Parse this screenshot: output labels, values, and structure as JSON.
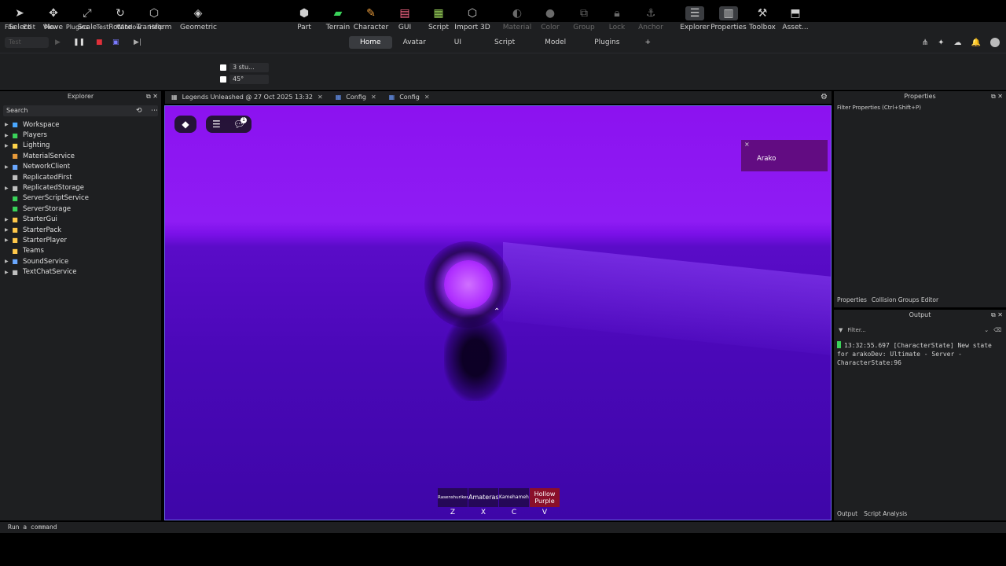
{
  "menu": [
    "File",
    "Edit",
    "View",
    "Plugins",
    "Test",
    "Window",
    "Help"
  ],
  "test_selector": "Test",
  "ribbon_tabs": [
    {
      "label": "Home",
      "active": true
    },
    {
      "label": "Avatar"
    },
    {
      "label": "UI"
    },
    {
      "label": "Script"
    },
    {
      "label": "Model"
    },
    {
      "label": "Plugins"
    },
    {
      "label": "+"
    }
  ],
  "tools": {
    "select": "Select",
    "move": "Move",
    "scale": "Scale",
    "rotate": "Rotate",
    "transform": "Transform",
    "geometric": "Geometric",
    "part": "Part",
    "terrain": "Terrain",
    "character": "Character",
    "gui": "GUI",
    "script": "Script",
    "import3d": "Import 3D",
    "material": "Material",
    "color": "Color",
    "group": "Group",
    "lock": "Lock",
    "anchor": "Anchor",
    "explorer": "Explorer",
    "properties": "Properties",
    "toolbox": "Toolbox",
    "assets": "Asset..."
  },
  "snap": {
    "move": "3 stu...",
    "rotate": "45°"
  },
  "explorer": {
    "title": "Explorer",
    "search_placeholder": "Search",
    "items": [
      {
        "label": "Workspace",
        "expand": true,
        "color": "#4aa8ff"
      },
      {
        "label": "Players",
        "expand": true,
        "color": "#3ad35a"
      },
      {
        "label": "Lighting",
        "expand": true,
        "color": "#ffd34a"
      },
      {
        "label": "MaterialService",
        "expand": false,
        "color": "#e89a3a"
      },
      {
        "label": "NetworkClient",
        "expand": true,
        "color": "#6aa8ff"
      },
      {
        "label": "ReplicatedFirst",
        "expand": false,
        "color": "#c0c0c0"
      },
      {
        "label": "ReplicatedStorage",
        "expand": true,
        "color": "#c0c0c0"
      },
      {
        "label": "ServerScriptService",
        "expand": false,
        "color": "#3ad35a"
      },
      {
        "label": "ServerStorage",
        "expand": false,
        "color": "#3ad35a"
      },
      {
        "label": "StarterGui",
        "expand": true,
        "color": "#ffc84a"
      },
      {
        "label": "StarterPack",
        "expand": true,
        "color": "#ffc84a"
      },
      {
        "label": "StarterPlayer",
        "expand": true,
        "color": "#ffc84a"
      },
      {
        "label": "Teams",
        "expand": false,
        "color": "#ffc84a"
      },
      {
        "label": "SoundService",
        "expand": true,
        "color": "#6aa8ff"
      },
      {
        "label": "TextChatService",
        "expand": true,
        "color": "#c0c0c0"
      }
    ]
  },
  "doc_tabs": [
    {
      "label": "Legends Unleashed @ 27 Oct 2025 13:32"
    },
    {
      "label": "Config"
    },
    {
      "label": "Config"
    }
  ],
  "game": {
    "player_name": "Arako",
    "close_glyph": "×",
    "hotbar": [
      {
        "name": "Rasenshuriken",
        "key": "Z"
      },
      {
        "name": "Amaterasu",
        "key": "X"
      },
      {
        "name": "Kamehameha",
        "key": "C"
      },
      {
        "name": "Hollow Purple",
        "key": "V",
        "selected": true
      }
    ]
  },
  "properties": {
    "title": "Properties",
    "filter_placeholder": "Filter Properties (Ctrl+Shift+P)",
    "tabs": [
      "Properties",
      "Collision Groups Editor"
    ]
  },
  "output": {
    "title": "Output",
    "filter_placeholder": "Filter...",
    "log": "13:32:55.697  [CharacterState] New state for arakoDev: Ultimate  -  Server - CharacterState:96",
    "tabs": [
      "Output",
      "Script Analysis"
    ]
  },
  "command_bar": {
    "placeholder": "Run a command"
  }
}
